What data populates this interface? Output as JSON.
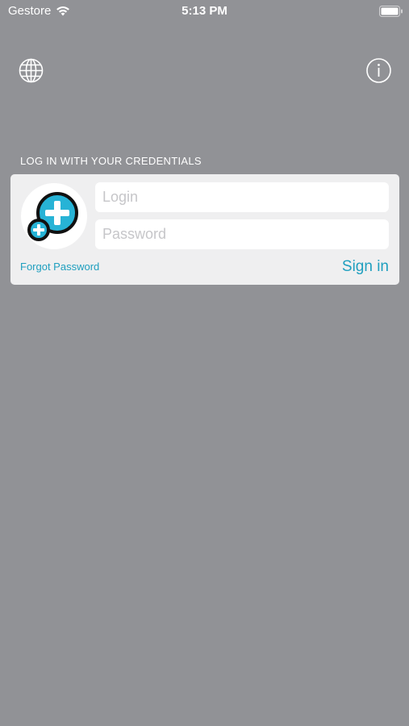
{
  "status_bar": {
    "carrier": "Gestore",
    "time": "5:13 PM",
    "icons": [
      "wifi-icon",
      "battery-icon"
    ]
  },
  "toolbar": {
    "left_icon": "globe-icon",
    "right_icon": "info-icon"
  },
  "login": {
    "section_header": "LOG IN WITH YOUR CREDENTIALS",
    "login_placeholder": "Login",
    "login_value": "",
    "password_placeholder": "Password",
    "password_value": "",
    "forgot_label": "Forgot Password",
    "signin_label": "Sign in",
    "logo_icon": "app-logo-plus-bubble"
  },
  "colors": {
    "background": "#919296",
    "card": "#efeff0",
    "accent": "#1f9fbf",
    "logo_fill": "#27b3d6"
  }
}
